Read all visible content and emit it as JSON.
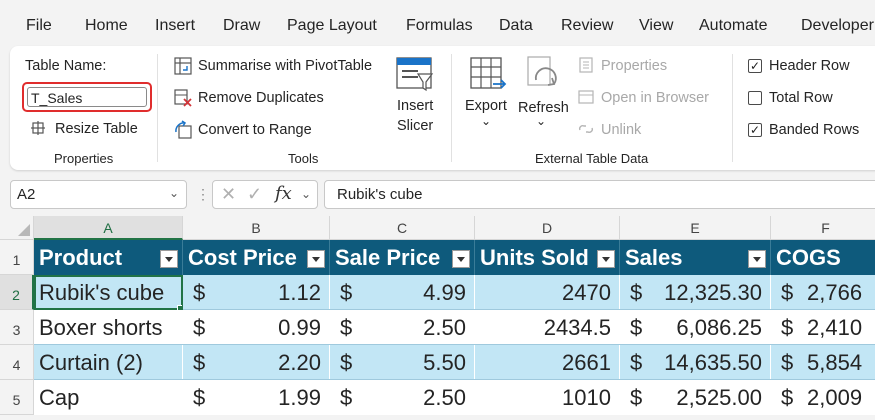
{
  "menu": [
    "File",
    "Home",
    "Insert",
    "Draw",
    "Page Layout",
    "Formulas",
    "Data",
    "Review",
    "View",
    "Automate",
    "Developer"
  ],
  "ribbon": {
    "properties": {
      "table_name_label": "Table Name:",
      "table_name_value": "T_Sales",
      "resize_label": "Resize Table",
      "group_label": "Properties"
    },
    "tools": {
      "pivot_label": "Summarise with PivotTable",
      "dupes_label": "Remove Duplicates",
      "range_label": "Convert to Range",
      "slicer_line1": "Insert",
      "slicer_line2": "Slicer",
      "group_label": "Tools"
    },
    "external": {
      "export_label": "Export",
      "refresh_label": "Refresh",
      "properties_label": "Properties",
      "browser_label": "Open in Browser",
      "unlink_label": "Unlink",
      "group_label": "External Table Data"
    },
    "style_options": {
      "header_row": {
        "label": "Header Row",
        "checked": true
      },
      "total_row": {
        "label": "Total Row",
        "checked": false
      },
      "banded_rows": {
        "label": "Banded Rows",
        "checked": true
      }
    }
  },
  "formula_bar": {
    "cell_ref": "A2",
    "fx": "fx",
    "content": "Rubik's cube"
  },
  "sheet": {
    "columns": [
      "A",
      "B",
      "C",
      "D",
      "E",
      "F"
    ],
    "rows": [
      "1",
      "2",
      "3",
      "4",
      "5"
    ],
    "headers": [
      "Product",
      "Cost Price",
      "Sale Price",
      "Units Sold",
      "Sales",
      "COGS"
    ],
    "data": [
      {
        "product": "Rubik's cube",
        "cost": "1.12",
        "sale": "4.99",
        "units": "2470",
        "sales": "12,325.30",
        "cogs": "2,766"
      },
      {
        "product": "Boxer shorts",
        "cost": "0.99",
        "sale": "2.50",
        "units": "2434.5",
        "sales": "6,086.25",
        "cogs": "2,410"
      },
      {
        "product": "Curtain (2)",
        "cost": "2.20",
        "sale": "5.50",
        "units": "2661",
        "sales": "14,635.50",
        "cogs": "5,854"
      },
      {
        "product": "Cap",
        "cost": "1.99",
        "sale": "2.50",
        "units": "1010",
        "sales": "2,525.00",
        "cogs": "2,009"
      }
    ],
    "currency": "$",
    "colors": {
      "header_bg": "#0e5a7c",
      "band": "#c2e6f5",
      "selection": "#217346"
    }
  }
}
